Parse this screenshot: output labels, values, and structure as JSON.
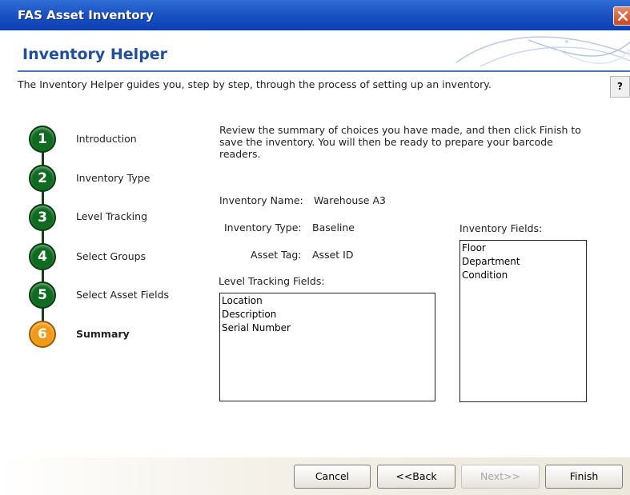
{
  "window": {
    "title": "FAS Asset Inventory"
  },
  "header": {
    "title": "Inventory Helper"
  },
  "intro_text": "The Inventory Helper guides you, step by step, through the process of setting up an inventory.",
  "help_label": "?",
  "steps": [
    {
      "number": "1",
      "label": "Introduction",
      "state": "done"
    },
    {
      "number": "2",
      "label": "Inventory Type",
      "state": "done"
    },
    {
      "number": "3",
      "label": "Level Tracking",
      "state": "done"
    },
    {
      "number": "4",
      "label": "Select Groups",
      "state": "done"
    },
    {
      "number": "5",
      "label": "Select Asset Fields",
      "state": "done"
    },
    {
      "number": "6",
      "label": "Summary",
      "state": "current"
    }
  ],
  "summary": {
    "description": "Review the summary of choices you have made, and then click Finish to save the inventory. You will then be ready to prepare your barcode readers.",
    "inventory_name_label": "Inventory Name:",
    "inventory_name": "Warehouse A3",
    "inventory_type_label": "Inventory Type:",
    "inventory_type": "Baseline",
    "asset_tag_label": "Asset Tag:",
    "asset_tag": "Asset ID",
    "level_tracking_label": "Level Tracking Fields:",
    "level_tracking_fields": [
      "Location",
      "Description",
      "Serial Number"
    ],
    "inventory_fields_label": "Inventory Fields:",
    "inventory_fields": [
      "Floor",
      "Department",
      "Condition"
    ]
  },
  "buttons": {
    "cancel": "Cancel",
    "back": "<<Back",
    "next": "Next>>",
    "finish": "Finish"
  },
  "colors": {
    "title_bar": "#1c53c4",
    "step_done": "#0e6b1f",
    "step_current": "#f29a16",
    "header_text": "#1f4fa0"
  }
}
